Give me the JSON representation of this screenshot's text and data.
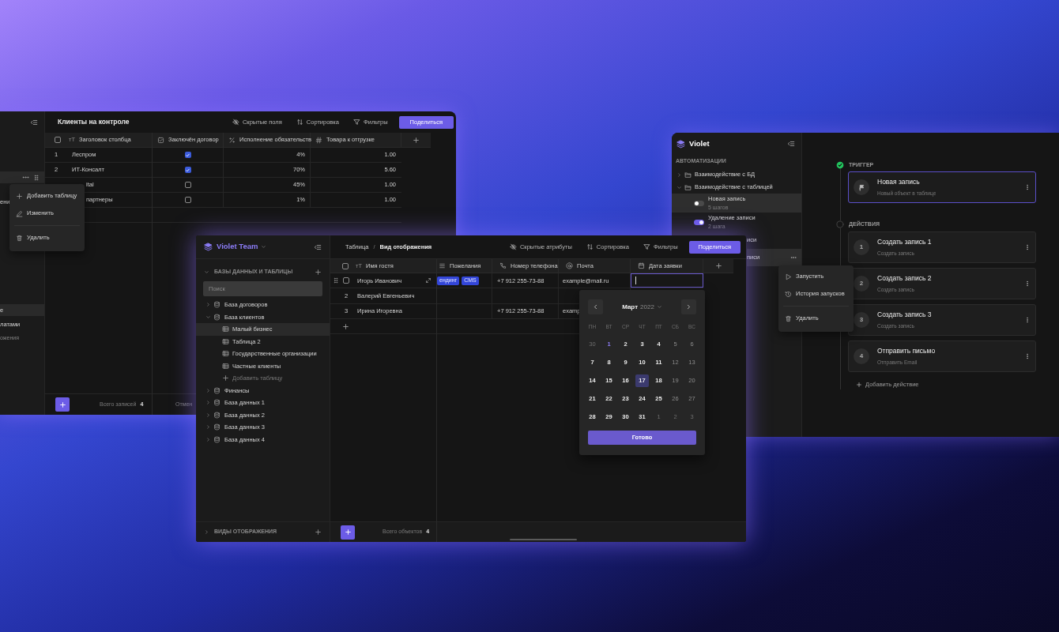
{
  "back_window": {
    "sidebar_items": [
      {
        "kind": "actions",
        "selected": true
      },
      {
        "kind": "item",
        "label": "ени",
        "selected": false
      },
      {
        "kind": "item",
        "label": "е",
        "selected": true
      },
      {
        "kind": "item",
        "label": "латами",
        "selected": false
      },
      {
        "kind": "caption",
        "label": "ожения"
      }
    ],
    "title": "Клиенты на контроле",
    "toolbar": [
      {
        "kind": "hidden",
        "label": "Скрытые поля"
      },
      {
        "kind": "sort",
        "label": "Сортировка"
      },
      {
        "kind": "filter",
        "label": "Фильтры"
      }
    ],
    "share_button": "Поделиться",
    "type_mark": "тT",
    "select_all": false,
    "columns": [
      {
        "kind": "text",
        "label": "Заголовок столбца"
      },
      {
        "kind": "checkbox",
        "label": "Заключён договор"
      },
      {
        "kind": "percent",
        "label": "Исполнение обязательств"
      },
      {
        "kind": "number",
        "label": "Товара к отгрузке"
      }
    ],
    "rows": [
      {
        "number": "1",
        "name": "Леспром",
        "contract": true,
        "fulfillment": "4%",
        "goods": "1.00"
      },
      {
        "number": "2",
        "name": "ИТ-Консалт",
        "contract": true,
        "fulfillment": "70%",
        "goods": "5.60"
      },
      {
        "name": "ital",
        "contract": false,
        "fulfillment": "45%",
        "goods": "1.00"
      },
      {
        "name": "партнеры",
        "contract": false,
        "fulfillment": "1%",
        "goods": "1.00"
      }
    ],
    "context_menu": [
      {
        "kind": "add",
        "label": "Добавить таблицу"
      },
      {
        "kind": "edit",
        "label": "Изменить"
      },
      {
        "kind": "delete",
        "label": "Удалить"
      }
    ],
    "footer": {
      "label": "Всего записей",
      "count": "4",
      "column_2": "Отмен"
    }
  },
  "main_window": {
    "brand": "Violet Team",
    "section": "БАЗЫ ДАННЫХ И ТАБЛИЦЫ",
    "search": {
      "placeholder": "Поиск"
    },
    "tree": [
      {
        "label": "База договоров",
        "expanded": false
      },
      {
        "label": "База клиентов",
        "expanded": true,
        "children": [
          {
            "kind": "table",
            "label": "Малый бизнес",
            "selected": true
          },
          {
            "kind": "table",
            "label": "Таблица 2",
            "selected": false
          },
          {
            "kind": "table",
            "label": "Государственные организации",
            "selected": false
          },
          {
            "kind": "table",
            "label": "Частные клиенты",
            "selected": false
          },
          {
            "kind": "add",
            "label": "Добавить таблицу",
            "selected": false
          }
        ]
      },
      {
        "label": "Финансы",
        "expanded": false
      },
      {
        "label": "База данных 1",
        "expanded": false
      },
      {
        "label": "База данных 2",
        "expanded": false
      },
      {
        "label": "База данных 3",
        "expanded": false
      },
      {
        "label": "База данных 4",
        "expanded": false
      }
    ],
    "views_section": "ВИДЫ ОТОБРАЖЕНИЯ",
    "breadcrumb": [
      "Таблица",
      "Вид отображения"
    ],
    "breadcrumb_separator": "/",
    "toolbar": [
      {
        "kind": "hidden",
        "label": "Скрытые атрибуты"
      },
      {
        "kind": "sort",
        "label": "Сортировка"
      },
      {
        "kind": "filter",
        "label": "Фильтры"
      }
    ],
    "share_button": "Поделиться",
    "type_mark": "тT",
    "select_all": false,
    "columns": [
      {
        "kind": "text",
        "label": "Имя гостя"
      },
      {
        "kind": "tags",
        "label": "Пожелания"
      },
      {
        "kind": "phone",
        "label": "Номер телефона"
      },
      {
        "kind": "email",
        "label": "Почта"
      },
      {
        "kind": "date",
        "label": "Дата заявки"
      }
    ],
    "rows": [
      {
        "hovered": true,
        "checked": false,
        "name": "Игорь Иванович",
        "tags": [
          "ендинг",
          "CMS"
        ],
        "phone": "+7 912 255-73-88",
        "email": "example@mail.ru",
        "date_editing": true
      },
      {
        "number": "2",
        "hovered": false,
        "name": "Валерий Евгеньевич",
        "date_editing": false
      },
      {
        "number": "3",
        "hovered": false,
        "name": "Ирина Игоревна",
        "phone": "+7 912 255-73-88",
        "email": "examp"
      }
    ],
    "footer": {
      "label": "Всего объектов",
      "count": "4"
    },
    "date_picker": {
      "month": "Март",
      "year": "2022",
      "weekdays": [
        "ПН",
        "ВТ",
        "СР",
        "ЧТ",
        "ПТ",
        "СБ",
        "ВС"
      ],
      "days": [
        {
          "label": "30",
          "kind": "other",
          "selected": false
        },
        {
          "label": "1",
          "kind": "today",
          "selected": false
        },
        {
          "label": "2",
          "kind": "day",
          "selected": false
        },
        {
          "label": "3",
          "kind": "day",
          "selected": false
        },
        {
          "label": "4",
          "kind": "day",
          "selected": false
        },
        {
          "label": "5",
          "kind": "weekend",
          "selected": false
        },
        {
          "label": "6",
          "kind": "weekend",
          "selected": false
        },
        {
          "label": "7",
          "kind": "day",
          "selected": false
        },
        {
          "label": "8",
          "kind": "day",
          "selected": false
        },
        {
          "label": "9",
          "kind": "day",
          "selected": false
        },
        {
          "label": "10",
          "kind": "day",
          "selected": false
        },
        {
          "label": "11",
          "kind": "day",
          "selected": false
        },
        {
          "label": "12",
          "kind": "weekend",
          "selected": false
        },
        {
          "label": "13",
          "kind": "weekend",
          "selected": false
        },
        {
          "label": "14",
          "kind": "day",
          "selected": false
        },
        {
          "label": "15",
          "kind": "day",
          "selected": false
        },
        {
          "label": "16",
          "kind": "day",
          "selected": false
        },
        {
          "label": "17",
          "kind": "day",
          "selected": true
        },
        {
          "label": "18",
          "kind": "day",
          "selected": false
        },
        {
          "label": "19",
          "kind": "weekend",
          "selected": false
        },
        {
          "label": "20",
          "kind": "weekend",
          "selected": false
        },
        {
          "label": "21",
          "kind": "day",
          "selected": false
        },
        {
          "label": "22",
          "kind": "day",
          "selected": false
        },
        {
          "label": "23",
          "kind": "day",
          "selected": false
        },
        {
          "label": "24",
          "kind": "day",
          "selected": false
        },
        {
          "label": "25",
          "kind": "day",
          "selected": false
        },
        {
          "label": "26",
          "kind": "weekend",
          "selected": false
        },
        {
          "label": "27",
          "kind": "weekend",
          "selected": false
        },
        {
          "label": "28",
          "kind": "day",
          "selected": false
        },
        {
          "label": "29",
          "kind": "day",
          "selected": false
        },
        {
          "label": "30",
          "kind": "day",
          "selected": false
        },
        {
          "label": "31",
          "kind": "day",
          "selected": false
        },
        {
          "label": "1",
          "kind": "other",
          "selected": false
        },
        {
          "label": "2",
          "kind": "other",
          "selected": false
        },
        {
          "label": "3",
          "kind": "other",
          "selected": false
        }
      ],
      "done_button": "Готово"
    }
  },
  "automation_window": {
    "brand": "Violet",
    "section": "АВТОМАТИЗАЦИИ",
    "folders": [
      {
        "label": "Взаимодействие с БД",
        "expanded": false
      },
      {
        "label": "Взаимодействие с таблицей",
        "expanded": true,
        "children": [
          {
            "kind": "automation",
            "label": "Новая запись",
            "steps": "5 шагов",
            "on": false,
            "selected": true
          },
          {
            "kind": "automation",
            "label": "Удаление записи",
            "steps": "2 шага",
            "on": true,
            "selected": false
          },
          {
            "kind": "clipped",
            "label": "иси",
            "selected": false,
            "menu_open": false
          },
          {
            "kind": "clipped",
            "label": "писи",
            "selected": true,
            "menu_open": true
          }
        ]
      }
    ],
    "context_menu": [
      {
        "kind": "run",
        "label": "Запустить"
      },
      {
        "kind": "history",
        "label": "История запусков"
      },
      {
        "kind": "delete",
        "label": "Удалить"
      }
    ],
    "trigger": {
      "label": "ТРИГГЕР",
      "done": true,
      "card": {
        "title": "Новая запись",
        "subtitle": "Новый объект в таблице",
        "selected": true
      }
    },
    "actions": {
      "label": "ДЕЙСТВИЯ",
      "done": false,
      "items": [
        {
          "number": "1",
          "title": "Создать запись 1",
          "subtitle": "Создать запись",
          "selected": false
        },
        {
          "number": "2",
          "title": "Создать запись 2",
          "subtitle": "Создать запись",
          "selected": false
        },
        {
          "number": "3",
          "title": "Создать запись 3",
          "subtitle": "Создать запись",
          "selected": false
        },
        {
          "number": "4",
          "title": "Отправить письмо",
          "subtitle": "Отправить Email",
          "selected": false
        }
      ],
      "add_label": "Добавить действие"
    }
  }
}
